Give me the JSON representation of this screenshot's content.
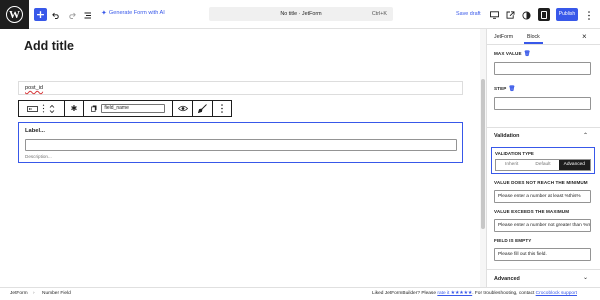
{
  "topbar": {
    "logo_letter": "W",
    "generate_label": "Generate Form with AI",
    "document_title": "No title · JetForm",
    "shortcut": "Ctrl+K",
    "save_draft": "Save draft",
    "publish": "Publish"
  },
  "editor": {
    "title_placeholder": "Add title",
    "field_name_text": "post_id",
    "toolbar_field_input": "field_name",
    "block_label": "Label...",
    "block_description": "Description..."
  },
  "statusbar": {
    "crumb_root": "JetForm",
    "crumb_sep": "›",
    "crumb_current": "Number Field",
    "footer_prefix": "Liked JetFormBuilder? Please",
    "footer_rate_link": "rate it ★★★★★",
    "footer_middle": ". For troubleshooting, contact",
    "footer_support_link": "Crocoblock support"
  },
  "inspector": {
    "tabs": [
      "JetForm",
      "Block"
    ],
    "active_tab": "Block",
    "max_value_label": "MAX VALUE",
    "step_label": "STEP",
    "validation_title": "Validation",
    "validation_type_label": "VALIDATION TYPE",
    "validation_options": [
      "Inherit",
      "Default",
      "Advanced"
    ],
    "validation_selected": "Advanced",
    "min_msg_label": "VALUE DOES NOT REACH THE MINIMUM",
    "min_msg_value": "Please enter a number at least %this%",
    "max_msg_label": "VALUE EXCEEDS THE MAXIMUM",
    "max_msg_value": "Please enter a number not greater than %max%",
    "empty_label": "FIELD IS EMPTY",
    "empty_value": "Please fill out this field.",
    "advanced_title": "Advanced"
  },
  "colors": {
    "accent": "#3858e9",
    "dark": "#1e1e1e",
    "border": "#e0e0e0"
  }
}
